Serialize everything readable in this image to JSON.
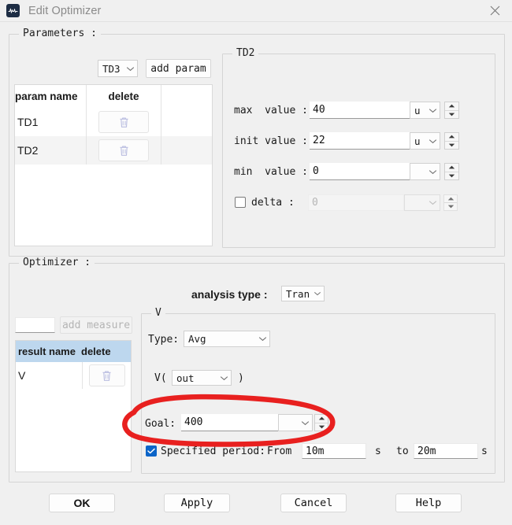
{
  "window": {
    "title": "Edit Optimizer",
    "icon": "waveform-icon",
    "close_label": "close-icon"
  },
  "parameters": {
    "group_title": "Parameters :",
    "param_select": {
      "value": "TD3",
      "options": [
        "TD1",
        "TD2",
        "TD3"
      ]
    },
    "add_param_label": "add param",
    "table": {
      "columns": [
        "param name",
        "delete"
      ],
      "rows": [
        {
          "name": "TD1",
          "delete_icon": "trash-icon"
        },
        {
          "name": "TD2",
          "delete_icon": "trash-icon"
        }
      ]
    },
    "detail": {
      "group_title": "TD2",
      "max_label": "max  value :",
      "max_value": "40",
      "max_unit": "u",
      "init_label": "init value :",
      "init_value": "22",
      "init_unit": "u",
      "min_label": "min  value :",
      "min_value": "0",
      "min_unit": "",
      "delta_label": "delta :",
      "delta_checked": false,
      "delta_value": "0",
      "delta_unit": ""
    }
  },
  "optimizer": {
    "group_title": "Optimizer :",
    "analysis_type_label": "analysis type :",
    "analysis_type_value": "Tran",
    "measure_input_value": "",
    "add_measure_label": "add measure",
    "add_measure_enabled": false,
    "result_table": {
      "columns": [
        "result name",
        "delete"
      ],
      "rows": [
        {
          "name": "V",
          "delete_icon": "trash-icon"
        }
      ]
    },
    "measure_detail": {
      "group_title": "V",
      "type_label": "Type:",
      "type_value": "Avg",
      "signal_prefix": "V(",
      "signal_value": "out",
      "signal_suffix": ")",
      "goal_label": "Goal:",
      "goal_value": "400",
      "goal_unit": "",
      "period_checked": true,
      "period_label": "Specified period:",
      "from_label": "From",
      "from_value": "10m",
      "from_unit": "s",
      "to_label": "to",
      "to_value": "20m",
      "to_unit": "s"
    }
  },
  "footer": {
    "ok": "OK",
    "apply": "Apply",
    "cancel": "Cancel",
    "help": "Help"
  },
  "annotation": {
    "shape": "red-ellipse-highlight",
    "color": "#e8201f",
    "target": "Goal: 400"
  }
}
